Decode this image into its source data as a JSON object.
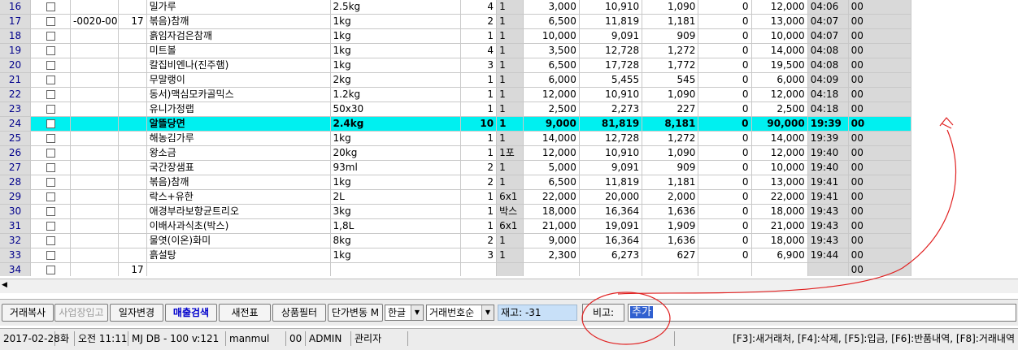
{
  "grid": {
    "rows": [
      {
        "no": "16",
        "code": "",
        "g": "",
        "name": "밀가루",
        "spec": "2.5kg",
        "qty": "4",
        "unit": "1",
        "price": "3,000",
        "supply": "10,910",
        "vat": "1,090",
        "disc": "0",
        "amount": "12,000",
        "time": "04:06",
        "flag": "00",
        "selected": false
      },
      {
        "no": "17",
        "code": "-0020-00",
        "g": "17",
        "name": "볶음)참깨",
        "spec": "1kg",
        "qty": "2",
        "unit": "1",
        "price": "6,500",
        "supply": "11,819",
        "vat": "1,181",
        "disc": "0",
        "amount": "13,000",
        "time": "04:07",
        "flag": "00",
        "selected": false
      },
      {
        "no": "18",
        "code": "",
        "g": "",
        "name": "흙임자검은참깨",
        "spec": "1kg",
        "qty": "1",
        "unit": "1",
        "price": "10,000",
        "supply": "9,091",
        "vat": "909",
        "disc": "0",
        "amount": "10,000",
        "time": "04:07",
        "flag": "00",
        "selected": false
      },
      {
        "no": "19",
        "code": "",
        "g": "",
        "name": "미트볼",
        "spec": "1kg",
        "qty": "4",
        "unit": "1",
        "price": "3,500",
        "supply": "12,728",
        "vat": "1,272",
        "disc": "0",
        "amount": "14,000",
        "time": "04:08",
        "flag": "00",
        "selected": false
      },
      {
        "no": "20",
        "code": "",
        "g": "",
        "name": "칼집비엔나(진주햄)",
        "spec": "1kg",
        "qty": "3",
        "unit": "1",
        "price": "6,500",
        "supply": "17,728",
        "vat": "1,772",
        "disc": "0",
        "amount": "19,500",
        "time": "04:08",
        "flag": "00",
        "selected": false
      },
      {
        "no": "21",
        "code": "",
        "g": "",
        "name": "무말랭이",
        "spec": "2kg",
        "qty": "1",
        "unit": "1",
        "price": "6,000",
        "supply": "5,455",
        "vat": "545",
        "disc": "0",
        "amount": "6,000",
        "time": "04:09",
        "flag": "00",
        "selected": false
      },
      {
        "no": "22",
        "code": "",
        "g": "",
        "name": "동서)맥심모카골믹스",
        "spec": "1.2kg",
        "qty": "1",
        "unit": "1",
        "price": "12,000",
        "supply": "10,910",
        "vat": "1,090",
        "disc": "0",
        "amount": "12,000",
        "time": "04:18",
        "flag": "00",
        "selected": false
      },
      {
        "no": "23",
        "code": "",
        "g": "",
        "name": "유니가정랩",
        "spec": "50x30",
        "qty": "1",
        "unit": "1",
        "price": "2,500",
        "supply": "2,273",
        "vat": "227",
        "disc": "0",
        "amount": "2,500",
        "time": "04:18",
        "flag": "00",
        "selected": false
      },
      {
        "no": "24",
        "code": "",
        "g": "",
        "name": "알뜰당면",
        "spec": "2.4kg",
        "qty": "10",
        "unit": "1",
        "price": "9,000",
        "supply": "81,819",
        "vat": "8,181",
        "disc": "0",
        "amount": "90,000",
        "time": "19:39",
        "flag": "00",
        "selected": true
      },
      {
        "no": "25",
        "code": "",
        "g": "",
        "name": "해농김가루",
        "spec": "1kg",
        "qty": "1",
        "unit": "1",
        "price": "14,000",
        "supply": "12,728",
        "vat": "1,272",
        "disc": "0",
        "amount": "14,000",
        "time": "19:39",
        "flag": "00",
        "selected": false
      },
      {
        "no": "26",
        "code": "",
        "g": "",
        "name": "왕소금",
        "spec": "20kg",
        "qty": "1",
        "unit": "1포",
        "price": "12,000",
        "supply": "10,910",
        "vat": "1,090",
        "disc": "0",
        "amount": "12,000",
        "time": "19:40",
        "flag": "00",
        "selected": false
      },
      {
        "no": "27",
        "code": "",
        "g": "",
        "name": "국간장샘표",
        "spec": "93ml",
        "qty": "2",
        "unit": "1",
        "price": "5,000",
        "supply": "9,091",
        "vat": "909",
        "disc": "0",
        "amount": "10,000",
        "time": "19:40",
        "flag": "00",
        "selected": false
      },
      {
        "no": "28",
        "code": "",
        "g": "",
        "name": "볶음)참깨",
        "spec": "1kg",
        "qty": "2",
        "unit": "1",
        "price": "6,500",
        "supply": "11,819",
        "vat": "1,181",
        "disc": "0",
        "amount": "13,000",
        "time": "19:41",
        "flag": "00",
        "selected": false
      },
      {
        "no": "29",
        "code": "",
        "g": "",
        "name": "락스+유한",
        "spec": "2L",
        "qty": "1",
        "unit": "6x1",
        "price": "22,000",
        "supply": "20,000",
        "vat": "2,000",
        "disc": "0",
        "amount": "22,000",
        "time": "19:41",
        "flag": "00",
        "selected": false
      },
      {
        "no": "30",
        "code": "",
        "g": "",
        "name": "애경부라보향균트리오",
        "spec": "3kg",
        "qty": "1",
        "unit": "박스",
        "price": "18,000",
        "supply": "16,364",
        "vat": "1,636",
        "disc": "0",
        "amount": "18,000",
        "time": "19:43",
        "flag": "00",
        "selected": false
      },
      {
        "no": "31",
        "code": "",
        "g": "",
        "name": "이배사과식초(박스)",
        "spec": "1,8L",
        "qty": "1",
        "unit": "6x1",
        "price": "21,000",
        "supply": "19,091",
        "vat": "1,909",
        "disc": "0",
        "amount": "21,000",
        "time": "19:43",
        "flag": "00",
        "selected": false
      },
      {
        "no": "32",
        "code": "",
        "g": "",
        "name": "물엿(이온)화미",
        "spec": "8kg",
        "qty": "2",
        "unit": "1",
        "price": "9,000",
        "supply": "16,364",
        "vat": "1,636",
        "disc": "0",
        "amount": "18,000",
        "time": "19:43",
        "flag": "00",
        "selected": false
      },
      {
        "no": "33",
        "code": "",
        "g": "",
        "name": "흙설탕",
        "spec": "1kg",
        "qty": "3",
        "unit": "1",
        "price": "2,300",
        "supply": "6,273",
        "vat": "627",
        "disc": "0",
        "amount": "6,900",
        "time": "19:44",
        "flag": "00",
        "selected": false
      },
      {
        "no": "34",
        "code": "",
        "g": "17",
        "name": "",
        "spec": "",
        "qty": "",
        "unit": "",
        "price": "",
        "supply": "",
        "vat": "",
        "disc": "",
        "amount": "",
        "time": "",
        "flag": "00",
        "selected": false
      }
    ]
  },
  "toolbar": {
    "copy": "거래복사",
    "business": "사업장입고",
    "date_change": "일자변경",
    "sales_search": "매출검색",
    "new_slip": "새전표",
    "product_filter": "상품필터",
    "price_change": "단가변동 M",
    "lang_select": "한글",
    "order_select": "거래번호순",
    "stock": "재고: -31",
    "memo_label": "비고:",
    "memo_value": "추가"
  },
  "status": {
    "date": "2017-02-28",
    "weekday": "화",
    "time": "오전 11:11",
    "db": "MJ DB - 100 v:121",
    "user": "manmul",
    "code": "00",
    "admin": "ADMIN",
    "role": "관리자",
    "shortcuts": "[F3]:새거래처, [F4]:삭제, [F5]:입금, [F6]:반품내역, [F8]:거래내역"
  },
  "colors": {
    "selected_row": "#00f0f0",
    "annotation": "#e02020"
  }
}
